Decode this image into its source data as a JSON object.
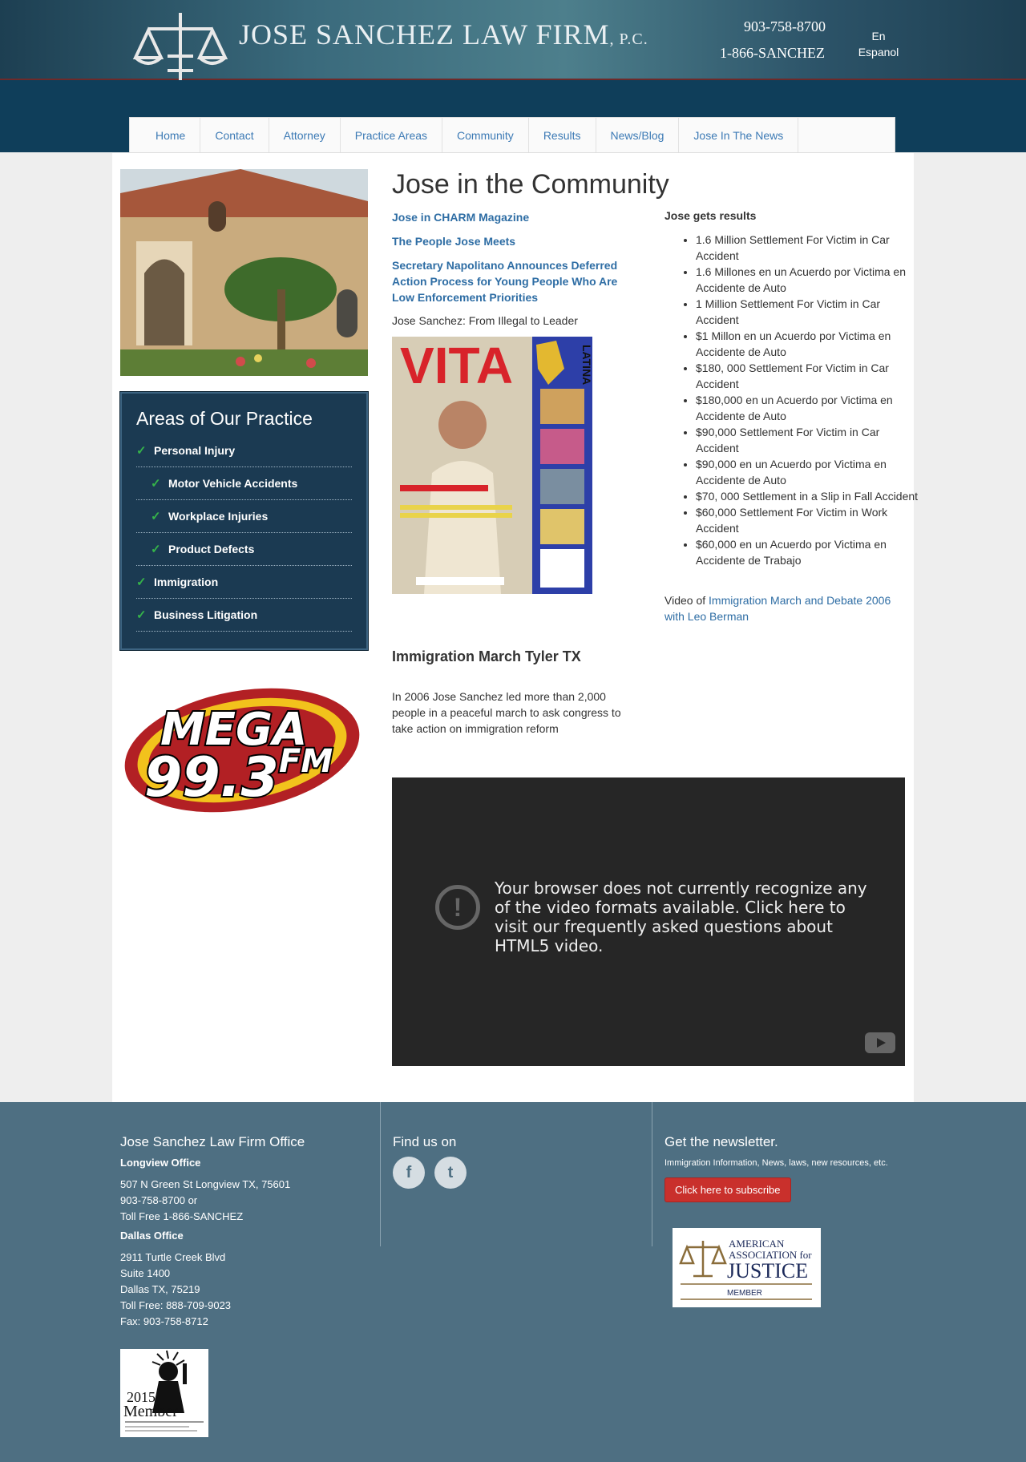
{
  "header": {
    "brand": "JOSE SANCHEZ LAW FIRM",
    "brand_suffix": "P.C.",
    "phone_local": "903-758-8700",
    "phone_toll": "1-866-SANCHEZ",
    "lang_line1": "En",
    "lang_line2": "Espanol"
  },
  "nav": {
    "items": [
      "Home",
      "Contact",
      "Attorney",
      "Practice Areas",
      "Community",
      "Results",
      "News/Blog",
      "Jose In The News"
    ]
  },
  "sidebar": {
    "areas_title": "Areas of Our Practice",
    "areas": [
      {
        "label": "Personal Injury",
        "sub": false
      },
      {
        "label": "Motor Vehicle Accidents",
        "sub": true
      },
      {
        "label": "Workplace Injuries",
        "sub": true
      },
      {
        "label": "Product Defects",
        "sub": true
      },
      {
        "label": "Immigration",
        "sub": false
      },
      {
        "label": "Business Litigation",
        "sub": false
      }
    ],
    "mega_line1": "MEGA",
    "mega_line2": "99.3",
    "mega_line3": "FM"
  },
  "main": {
    "title": "Jose in the Community",
    "links": [
      "Jose in CHARM Magazine",
      "The People Jose Meets",
      "Secretary Napolitano Announces Deferred Action Process for Young People Who Are Low Enforcement Priorities"
    ],
    "caption": "Jose Sanchez: From Illegal to Leader",
    "magazine_title": "VITA",
    "magazine_sub": "LATINA",
    "results_title": "Jose gets results",
    "results": [
      "1.6 Million Settlement For Victim in Car Accident",
      "1.6 Millones en un Acuerdo por Victima en Accidente de Auto",
      "1 Million Settlement For Victim in Car Accident",
      "$1 Millon en un Acuerdo por Victima en Accidente de Auto",
      "$180, 000 Settlement For Victim in Car Accident",
      "$180,000 en un Acuerdo por Victima en Accidente de Auto",
      "$90,000 Settlement For Victim in Car Accident",
      "$90,000 en un Acuerdo por Victima en Accidente de Auto",
      "$70, 000 Settlement in a Slip in Fall Accident",
      "$60,000 Settlement For Victim in Work Accident",
      "$60,000 en un Acuerdo por Victima en Accidente de Trabajo"
    ],
    "video_of_prefix": "Video of ",
    "video_of_link": "Immigration March and Debate 2006 with Leo Berman",
    "immig_title": "Immigration March Tyler TX",
    "immig_text": "In 2006 Jose Sanchez led more than 2,000 people in a peaceful march to ask congress to take action on immigration reform",
    "video_msg": "Your browser does not currently recognize any of the video formats available.",
    "video_link": "Click here to visit our frequently asked questions about HTML5 video."
  },
  "footer": {
    "office_title": "Jose Sanchez Law Firm Office",
    "longview_title": "Longview Office",
    "longview_lines": [
      "507 N Green St Longview TX, 75601",
      "903-758-8700 or",
      "Toll Free 1-866-SANCHEZ"
    ],
    "dallas_title": "Dallas Office",
    "dallas_lines": [
      "2911 Turtle Creek Blvd",
      "Suite 1400",
      "Dallas TX, 75219",
      "Toll Free: 888-709-9023",
      "Fax: 903-758-8712"
    ],
    "find_title": "Find us on",
    "newsletter_title": "Get the newsletter.",
    "newsletter_desc": "Immigration Information, News, laws, new resources, etc.",
    "subscribe_label": "Click here to subscribe",
    "aaj_line1": "AMERICAN",
    "aaj_line2": "ASSOCIATION for",
    "aaj_line3": "JUSTICE",
    "aaj_line4": "MEMBER",
    "aila_year": "2015",
    "aila_member": "Member"
  },
  "colors": {
    "nav_link": "#3c7ab5",
    "sidebar_bg": "#1b3a52",
    "check": "#35b34a",
    "footer_bg": "#4e6f82",
    "subscribe": "#c9302c"
  }
}
